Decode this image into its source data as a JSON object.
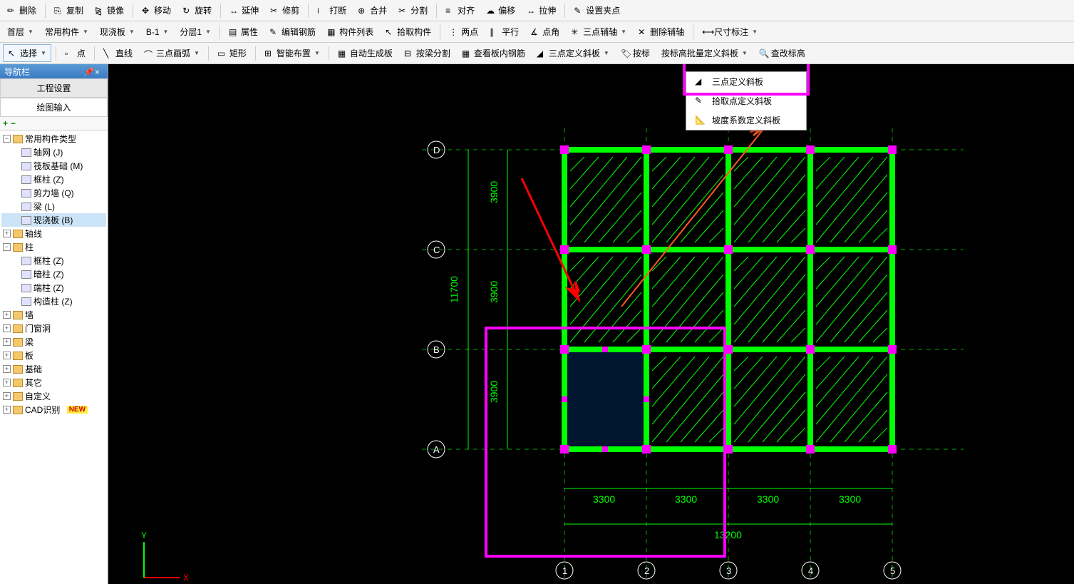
{
  "toolbar1": {
    "delete": "删除",
    "copy": "复制",
    "mirror": "镜像",
    "move": "移动",
    "rotate": "旋转",
    "extend": "延伸",
    "trim": "修剪",
    "break": "打断",
    "merge": "合并",
    "split": "分割",
    "align": "对齐",
    "offset": "偏移",
    "stretch": "拉伸",
    "set_grip": "设置夹点"
  },
  "toolbar2": {
    "floor": "首层",
    "common": "常用构件",
    "cast": "现浇板",
    "b1": "B-1",
    "layer": "分层1",
    "props": "属性",
    "edit_rebar": "编辑钢筋",
    "component_list": "构件列表",
    "pick": "拾取构件",
    "two_point": "两点",
    "parallel": "平行",
    "point_angle": "点角",
    "three_aux": "三点辅轴",
    "del_aux": "删除辅轴",
    "dim": "尺寸标注"
  },
  "toolbar3": {
    "select": "选择",
    "point": "点",
    "line": "直线",
    "arc3": "三点画弧",
    "rect": "矩形",
    "smart": "智能布置",
    "auto_slab": "自动生成板",
    "split_beam": "按梁分割",
    "view_rebar": "查看板内钢筋",
    "three_slope": "三点定义斜板",
    "by_elev": "按标高批量定义斜板",
    "check_elev": "查改标高",
    "by_label": "按标"
  },
  "popup": {
    "item1": "三点定义斜板",
    "item2": "拾取点定义斜板",
    "item3": "坡度系数定义斜板"
  },
  "sidebar": {
    "title": "导航栏",
    "tab1": "工程设置",
    "tab2": "绘图输入",
    "nodes": {
      "common_types": "常用构件类型",
      "axis_net": "轴网 (J)",
      "raft": "筏板基础 (M)",
      "frame_col": "框柱 (Z)",
      "shear_wall": "剪力墙 (Q)",
      "beam": "梁 (L)",
      "cast_slab": "现浇板 (B)",
      "axis_line": "轴线",
      "column": "柱",
      "frame_col2": "框柱 (Z)",
      "hidden_col": "暗柱 (Z)",
      "end_col": "端柱 (Z)",
      "constr_col": "构造柱 (Z)",
      "wall": "墙",
      "opening": "门窗洞",
      "beam2": "梁",
      "slab": "板",
      "foundation": "基础",
      "other": "其它",
      "custom": "自定义",
      "cad_recog": "CAD识别",
      "new_badge": "NEW"
    }
  },
  "drawing": {
    "axis_x": [
      "1",
      "2",
      "3",
      "4",
      "5"
    ],
    "axis_y": [
      "A",
      "B",
      "C",
      "D"
    ],
    "dim_h": "3300",
    "dim_v": "3900",
    "total_h": "13200",
    "total_v": "11700"
  },
  "ucs": {
    "x": "X",
    "y": "Y"
  }
}
